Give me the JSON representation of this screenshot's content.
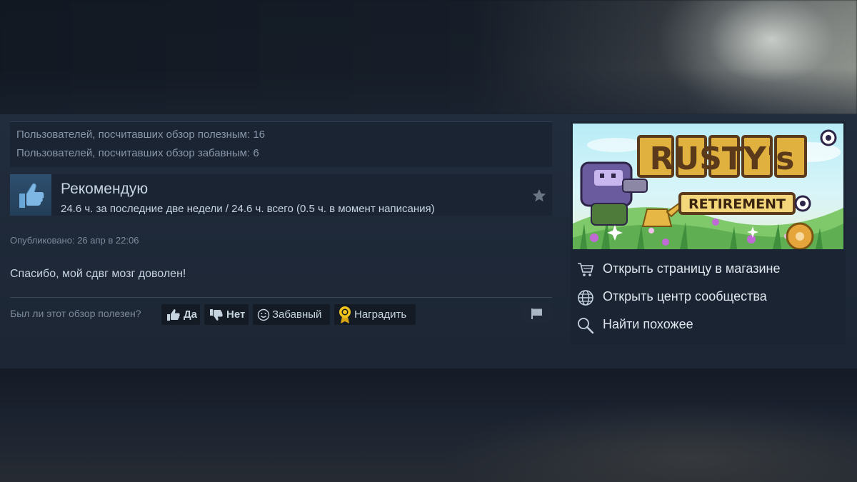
{
  "review": {
    "helpful_count_text": "Пользователей, посчитавших обзор полезным: 16",
    "funny_count_text": "Пользователей, посчитавших обзор забавным: 6",
    "recommendation": "Рекомендую",
    "hours": "24.6 ч. за последние две недели / 24.6 ч. всего (0.5 ч. в момент написания)",
    "posted": "Опубликовано: 26 апр в 22:06",
    "body": "Спасибо, мой сдвг мозг доволен!",
    "helpful_question": "Был ли этот обзор полезен?",
    "buttons": {
      "yes": "Да",
      "no": "Нет",
      "funny": "Забавный",
      "award": "Наградить"
    }
  },
  "game": {
    "capsule_title_main": "RUSTY's",
    "capsule_title_sub": "RETIREMENT",
    "links": [
      {
        "label": "Открыть страницу в магазине",
        "icon": "cart-icon"
      },
      {
        "label": "Открыть центр сообщества",
        "icon": "globe-icon"
      },
      {
        "label": "Найти похожее",
        "icon": "magnifier-icon"
      }
    ]
  },
  "colors": {
    "band": "#1f2a3a",
    "text_primary": "#c6d4df",
    "text_muted": "#7d8b9c",
    "award_gold": "#f3c21b",
    "thumb_tile": "#2a4966"
  }
}
